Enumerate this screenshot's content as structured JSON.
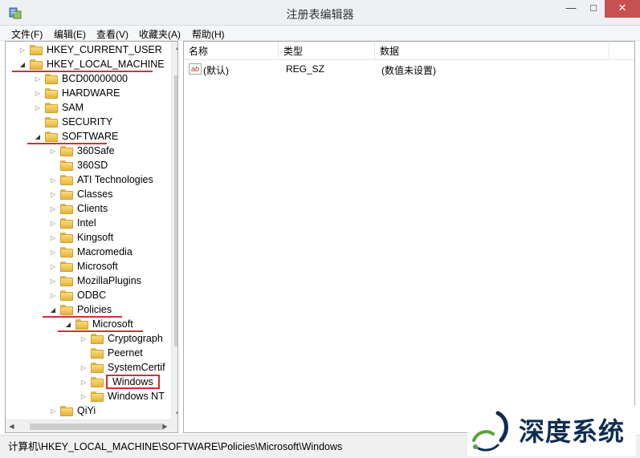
{
  "window": {
    "title": "注册表编辑器",
    "controls": {
      "minimize": "—",
      "maximize": "□",
      "close": "✕"
    }
  },
  "menu": [
    "文件(F)",
    "编辑(E)",
    "查看(V)",
    "收藏夹(A)",
    "帮助(H)"
  ],
  "tree": [
    {
      "label": "HKEY_CURRENT_USER",
      "depth": 0,
      "expanded": false,
      "underlined": false,
      "boxed": false
    },
    {
      "label": "HKEY_LOCAL_MACHINE",
      "depth": 0,
      "expanded": true,
      "underlined": true,
      "boxed": false
    },
    {
      "label": "BCD00000000",
      "depth": 1,
      "expanded": false,
      "underlined": false,
      "boxed": false
    },
    {
      "label": "HARDWARE",
      "depth": 1,
      "expanded": false,
      "underlined": false,
      "boxed": false
    },
    {
      "label": "SAM",
      "depth": 1,
      "expanded": false,
      "underlined": false,
      "boxed": false
    },
    {
      "label": "SECURITY",
      "depth": 1,
      "expanded": null,
      "underlined": false,
      "boxed": false
    },
    {
      "label": "SOFTWARE",
      "depth": 1,
      "expanded": true,
      "underlined": true,
      "boxed": false
    },
    {
      "label": "360Safe",
      "depth": 2,
      "expanded": false,
      "underlined": false,
      "boxed": false
    },
    {
      "label": "360SD",
      "depth": 2,
      "expanded": null,
      "underlined": false,
      "boxed": false
    },
    {
      "label": "ATI Technologies",
      "depth": 2,
      "expanded": false,
      "underlined": false,
      "boxed": false
    },
    {
      "label": "Classes",
      "depth": 2,
      "expanded": false,
      "underlined": false,
      "boxed": false
    },
    {
      "label": "Clients",
      "depth": 2,
      "expanded": false,
      "underlined": false,
      "boxed": false
    },
    {
      "label": "Intel",
      "depth": 2,
      "expanded": false,
      "underlined": false,
      "boxed": false
    },
    {
      "label": "Kingsoft",
      "depth": 2,
      "expanded": false,
      "underlined": false,
      "boxed": false
    },
    {
      "label": "Macromedia",
      "depth": 2,
      "expanded": false,
      "underlined": false,
      "boxed": false
    },
    {
      "label": "Microsoft",
      "depth": 2,
      "expanded": false,
      "underlined": false,
      "boxed": false
    },
    {
      "label": "MozillaPlugins",
      "depth": 2,
      "expanded": false,
      "underlined": false,
      "boxed": false
    },
    {
      "label": "ODBC",
      "depth": 2,
      "expanded": false,
      "underlined": false,
      "boxed": false
    },
    {
      "label": "Policies",
      "depth": 2,
      "expanded": true,
      "underlined": true,
      "boxed": false
    },
    {
      "label": "Microsoft",
      "depth": 3,
      "expanded": true,
      "underlined": true,
      "boxed": false
    },
    {
      "label": "Cryptograph",
      "depth": 4,
      "expanded": false,
      "underlined": false,
      "boxed": false
    },
    {
      "label": "Peernet",
      "depth": 4,
      "expanded": null,
      "underlined": false,
      "boxed": false
    },
    {
      "label": "SystemCertif",
      "depth": 4,
      "expanded": false,
      "underlined": false,
      "boxed": false
    },
    {
      "label": "Windows",
      "depth": 4,
      "expanded": false,
      "underlined": false,
      "boxed": true
    },
    {
      "label": "Windows NT",
      "depth": 4,
      "expanded": false,
      "underlined": false,
      "boxed": false
    },
    {
      "label": "QiYi",
      "depth": 2,
      "expanded": false,
      "underlined": false,
      "boxed": false
    }
  ],
  "list": {
    "columns": [
      "名称",
      "类型",
      "数据"
    ],
    "rows": [
      {
        "icon": "ab",
        "name": "(默认)",
        "type": "REG_SZ",
        "data": "(数值未设置)"
      }
    ]
  },
  "status_path": "计算机\\HKEY_LOCAL_MACHINE\\SOFTWARE\\Policies\\Microsoft\\Windows",
  "watermark": {
    "text": "深度系统"
  },
  "colors": {
    "highlight": "#d32f2f",
    "folder": "#f1c95a",
    "watermark": "#0f2d52"
  }
}
